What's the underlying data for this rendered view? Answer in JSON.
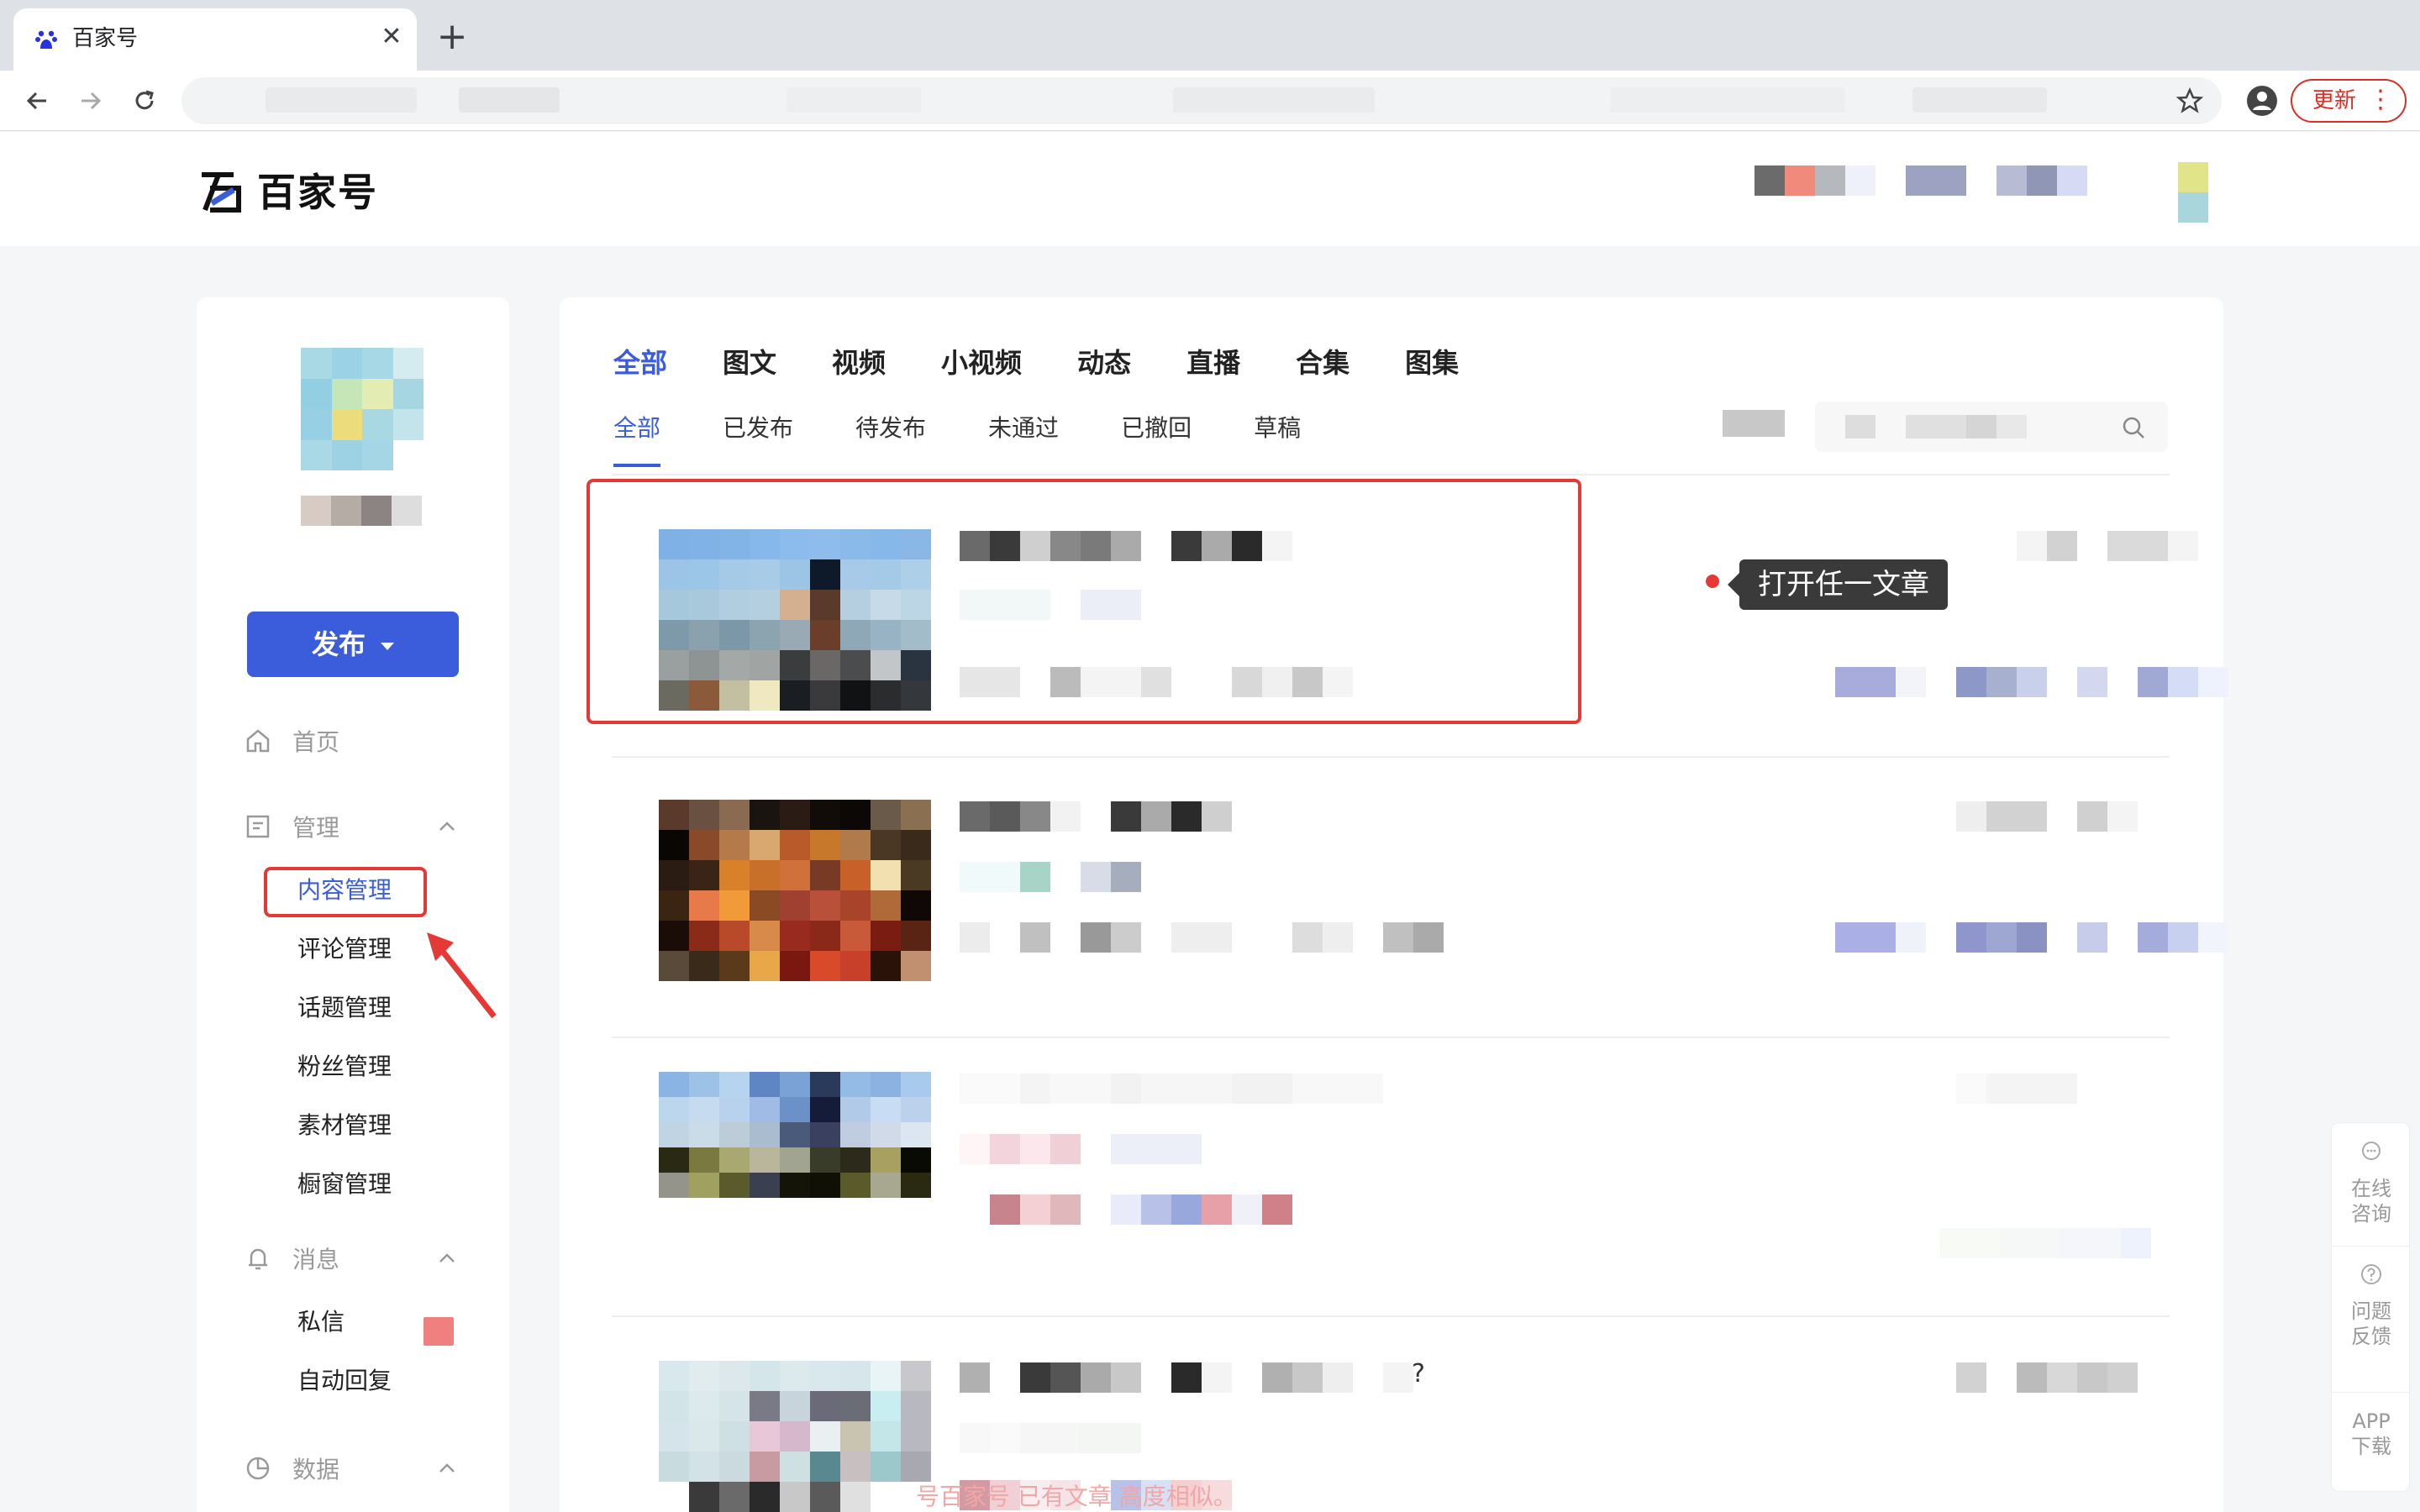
{
  "browser": {
    "tab_title": "百家号",
    "tab_close": "✕",
    "new_tab": "+",
    "update_label": "更新",
    "update_menu": "⋮"
  },
  "site": {
    "logo_text": "百家号"
  },
  "sidebar": {
    "publish_label": "发布",
    "nav": [
      {
        "label": "首页",
        "icon": "home-icon"
      },
      {
        "label": "管理",
        "icon": "manage-icon"
      },
      {
        "label": "消息",
        "icon": "bell-icon"
      },
      {
        "label": "数据",
        "icon": "chart-pie-icon"
      }
    ],
    "manage_items": [
      "内容管理",
      "评论管理",
      "话题管理",
      "粉丝管理",
      "素材管理",
      "橱窗管理"
    ],
    "message_items": [
      "私信",
      "自动回复"
    ]
  },
  "main": {
    "primary_tabs": [
      "全部",
      "图文",
      "视频",
      "小视频",
      "动态",
      "直播",
      "合集",
      "图集"
    ],
    "status_tabs": [
      "全部",
      "已发布",
      "待发布",
      "未通过",
      "已撤回",
      "草稿"
    ]
  },
  "annotation": {
    "tooltip": "打开任一文章"
  },
  "row4": {
    "title_tail": "?"
  },
  "float_panel": {
    "consult": "在线\n咨询",
    "feedback": "问题\n反馈",
    "app": "APP\n下载"
  },
  "faint_text": "号百家号 已有文章 高度相似。",
  "colors": {
    "accent": "#3b5cdb",
    "annotation_red": "#e53935",
    "update_red": "#d93025"
  }
}
